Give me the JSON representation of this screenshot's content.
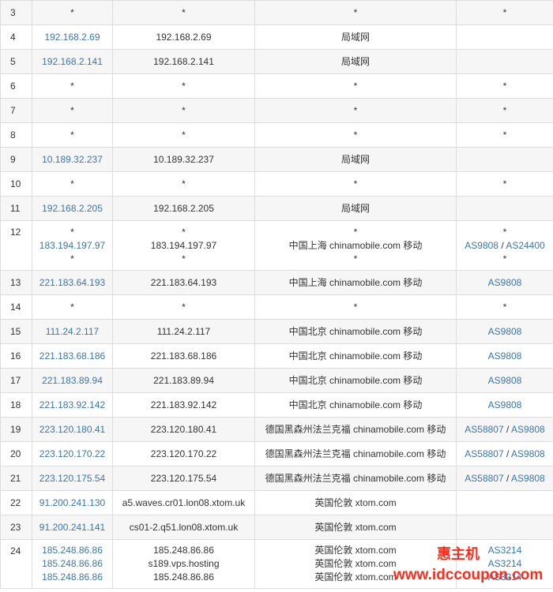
{
  "hops": [
    {
      "hop": "3",
      "ip": [
        "*"
      ],
      "host": [
        "*"
      ],
      "loc": [
        "*"
      ],
      "asn": [
        [
          "*"
        ]
      ]
    },
    {
      "hop": "4",
      "ip": [
        "192.168.2.69"
      ],
      "host": [
        "192.168.2.69"
      ],
      "loc": [
        "局域网"
      ],
      "asn": [
        []
      ]
    },
    {
      "hop": "5",
      "ip": [
        "192.168.2.141"
      ],
      "host": [
        "192.168.2.141"
      ],
      "loc": [
        "局域网"
      ],
      "asn": [
        []
      ]
    },
    {
      "hop": "6",
      "ip": [
        "*"
      ],
      "host": [
        "*"
      ],
      "loc": [
        "*"
      ],
      "asn": [
        [
          "*"
        ]
      ]
    },
    {
      "hop": "7",
      "ip": [
        "*"
      ],
      "host": [
        "*"
      ],
      "loc": [
        "*"
      ],
      "asn": [
        [
          "*"
        ]
      ]
    },
    {
      "hop": "8",
      "ip": [
        "*"
      ],
      "host": [
        "*"
      ],
      "loc": [
        "*"
      ],
      "asn": [
        [
          "*"
        ]
      ]
    },
    {
      "hop": "9",
      "ip": [
        "10.189.32.237"
      ],
      "host": [
        "10.189.32.237"
      ],
      "loc": [
        "局域网"
      ],
      "asn": [
        []
      ]
    },
    {
      "hop": "10",
      "ip": [
        "*"
      ],
      "host": [
        "*"
      ],
      "loc": [
        "*"
      ],
      "asn": [
        [
          "*"
        ]
      ]
    },
    {
      "hop": "11",
      "ip": [
        "192.168.2.205"
      ],
      "host": [
        "192.168.2.205"
      ],
      "loc": [
        "局域网"
      ],
      "asn": [
        []
      ]
    },
    {
      "hop": "12",
      "ip": [
        "*",
        "183.194.197.97",
        "*"
      ],
      "host": [
        "*",
        "183.194.197.97",
        "*"
      ],
      "loc": [
        "*",
        "中国上海 chinamobile.com 移动",
        "*"
      ],
      "asn": [
        [
          "*"
        ],
        [
          "AS9808",
          "AS24400"
        ],
        [
          "*"
        ]
      ]
    },
    {
      "hop": "13",
      "ip": [
        "221.183.64.193"
      ],
      "host": [
        "221.183.64.193"
      ],
      "loc": [
        "中国上海 chinamobile.com 移动"
      ],
      "asn": [
        [
          "AS9808"
        ]
      ]
    },
    {
      "hop": "14",
      "ip": [
        "*"
      ],
      "host": [
        "*"
      ],
      "loc": [
        "*"
      ],
      "asn": [
        [
          "*"
        ]
      ]
    },
    {
      "hop": "15",
      "ip": [
        "111.24.2.117"
      ],
      "host": [
        "111.24.2.117"
      ],
      "loc": [
        "中国北京 chinamobile.com 移动"
      ],
      "asn": [
        [
          "AS9808"
        ]
      ]
    },
    {
      "hop": "16",
      "ip": [
        "221.183.68.186"
      ],
      "host": [
        "221.183.68.186"
      ],
      "loc": [
        "中国北京 chinamobile.com 移动"
      ],
      "asn": [
        [
          "AS9808"
        ]
      ]
    },
    {
      "hop": "17",
      "ip": [
        "221.183.89.94"
      ],
      "host": [
        "221.183.89.94"
      ],
      "loc": [
        "中国北京 chinamobile.com 移动"
      ],
      "asn": [
        [
          "AS9808"
        ]
      ]
    },
    {
      "hop": "18",
      "ip": [
        "221.183.92.142"
      ],
      "host": [
        "221.183.92.142"
      ],
      "loc": [
        "中国北京 chinamobile.com 移动"
      ],
      "asn": [
        [
          "AS9808"
        ]
      ]
    },
    {
      "hop": "19",
      "ip": [
        "223.120.180.41"
      ],
      "host": [
        "223.120.180.41"
      ],
      "loc": [
        "德国黑森州法兰克福 chinamobile.com 移动"
      ],
      "asn": [
        [
          "AS58807",
          "AS9808"
        ]
      ]
    },
    {
      "hop": "20",
      "ip": [
        "223.120.170.22"
      ],
      "host": [
        "223.120.170.22"
      ],
      "loc": [
        "德国黑森州法兰克福 chinamobile.com 移动"
      ],
      "asn": [
        [
          "AS58807",
          "AS9808"
        ]
      ]
    },
    {
      "hop": "21",
      "ip": [
        "223.120.175.54"
      ],
      "host": [
        "223.120.175.54"
      ],
      "loc": [
        "德国黑森州法兰克福 chinamobile.com 移动"
      ],
      "asn": [
        [
          "AS58807",
          "AS9808"
        ]
      ]
    },
    {
      "hop": "22",
      "ip": [
        "91.200.241.130"
      ],
      "host": [
        "a5.waves.cr01.lon08.xtom.uk"
      ],
      "loc": [
        "英国伦敦 xtom.com"
      ],
      "asn": [
        []
      ]
    },
    {
      "hop": "23",
      "ip": [
        "91.200.241.141"
      ],
      "host": [
        "cs01-2.q51.lon08.xtom.uk"
      ],
      "loc": [
        "英国伦敦 xtom.com"
      ],
      "asn": [
        []
      ]
    },
    {
      "hop": "24",
      "ip": [
        "185.248.86.86",
        "185.248.86.86",
        "185.248.86.86"
      ],
      "host": [
        "185.248.86.86",
        "s189.vps.hosting",
        "185.248.86.86"
      ],
      "loc": [
        "英国伦敦 xtom.com",
        "英国伦敦 xtom.com",
        "英国伦敦 xtom.com"
      ],
      "asn": [
        [
          "AS3214"
        ],
        [
          "AS3214"
        ],
        [
          "AS3214"
        ]
      ]
    }
  ],
  "watermark": {
    "top": "惠主机",
    "bottom": "www.idccoupon.com"
  }
}
